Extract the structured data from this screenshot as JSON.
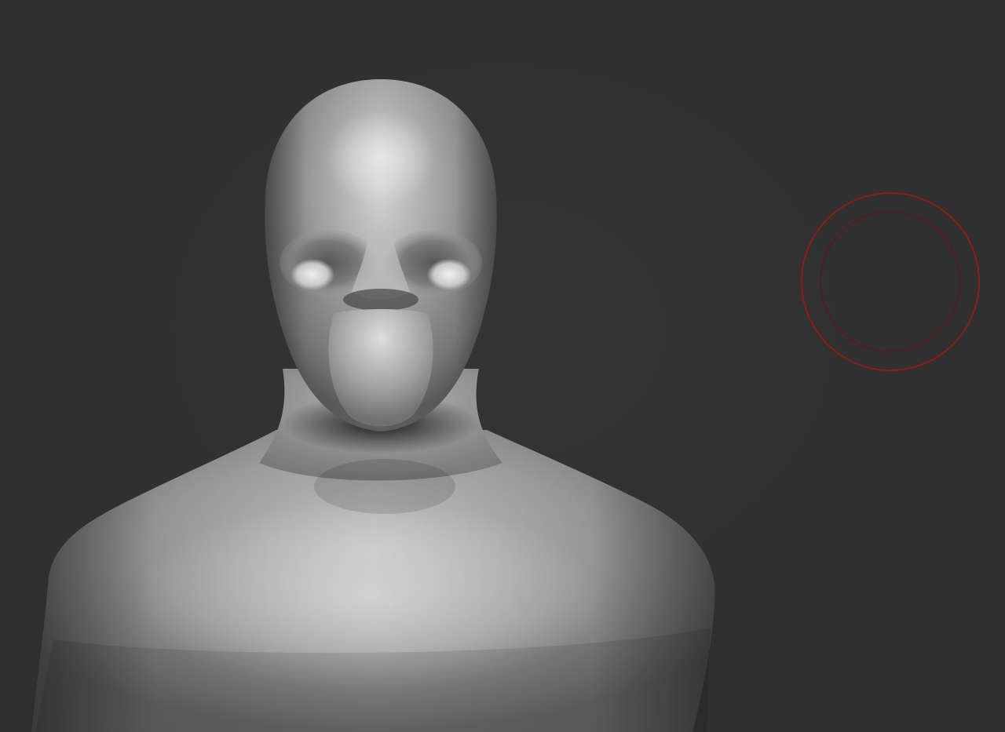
{
  "viewport": {
    "background_color": "#303030"
  },
  "model": {
    "kind": "bust-sculpt",
    "material": "matcap-gray",
    "base_color": "#9a9a9a",
    "highlight_color": "#d8d8d8",
    "shadow_color": "#1c1c1c"
  },
  "brush_cursor": {
    "outer_ring_color": "#8e1c1c",
    "inner_ring_color": "#5a1a1a"
  }
}
